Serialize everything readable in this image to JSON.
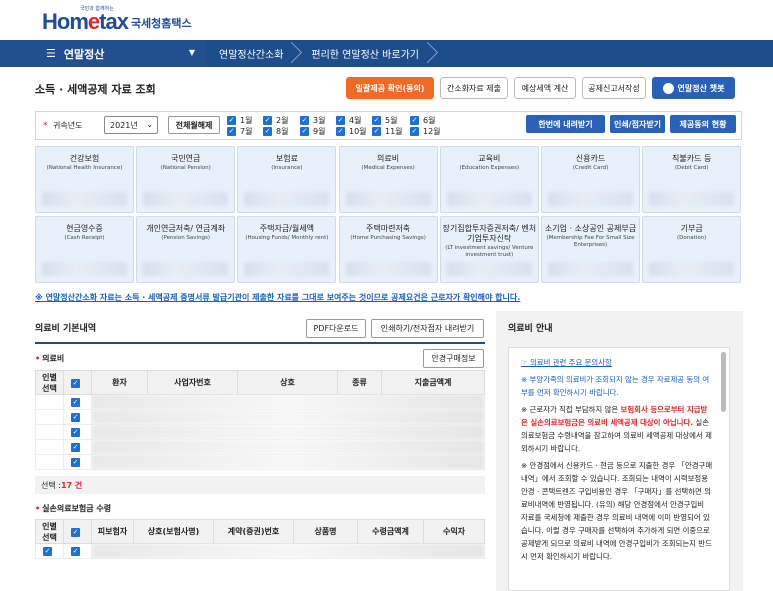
{
  "header": {
    "logo_text_home": "Hom",
    "logo_text_e": "e",
    "logo_text_tax": "tax",
    "logo_korean": "국세청홈택스",
    "logo_tagline": "국민과 함께하는"
  },
  "nav": {
    "menu_label": "연말정산",
    "crumbs": [
      "연말정산간소화",
      "편리한 연말정산 바로가기"
    ]
  },
  "page": {
    "title": "소득 · 세액공제 자료 조회",
    "buttons": {
      "bulk_consent": "일괄제공 확인(동의)",
      "simplified_submit": "간소화자료 제출",
      "tax_estimate": "예상세액 계산",
      "report_create": "공제신고서작성",
      "chatbot": "연말정산 챗봇"
    }
  },
  "filter": {
    "year_label": "귀속년도",
    "year_value": "2021년",
    "toggle_all": "전체월해제",
    "months_row1": [
      "1월",
      "2월",
      "3월",
      "4월",
      "5월",
      "6월"
    ],
    "months_row2": [
      "7월",
      "8월",
      "9월",
      "10월",
      "11월",
      "12월"
    ],
    "download_all": "한번에 내려받기",
    "print_download": "인쇄/점자받기",
    "provider_status": "제공동의 현황"
  },
  "categories": [
    {
      "ko": "건강보험",
      "en": "(National Health Insurance)"
    },
    {
      "ko": "국민연금",
      "en": "(National Pension)"
    },
    {
      "ko": "보험료",
      "en": "(Insurance)"
    },
    {
      "ko": "의료비",
      "en": "(Medical Expenses)"
    },
    {
      "ko": "교육비",
      "en": "(Education Expenses)"
    },
    {
      "ko": "신용카드",
      "en": "(Credit Card)"
    },
    {
      "ko": "직불카드 등",
      "en": "(Debit Card)"
    },
    {
      "ko": "현금영수증",
      "en": "(Cash Receipt)"
    },
    {
      "ko": "개인연금저축/ 연금계좌",
      "en": "(Pension Savings)"
    },
    {
      "ko": "주택자금/월세액",
      "en": "(Housing Funds/ Monthly rent)"
    },
    {
      "ko": "주택마련저축",
      "en": "(Home Purchasing Savings)"
    },
    {
      "ko": "장기집합투자증권저축/ 벤처기업투자신탁",
      "en": "(LT investment savings/ Venture investment trust)"
    },
    {
      "ko": "소기업 · 소상공인 공제부금",
      "en": "(Membership Fee For Small Size Enterprises)"
    },
    {
      "ko": "기부금",
      "en": "(Donation)"
    }
  ],
  "notice": "※ 연말정산간소화 자료는 소득 · 세액공제 증명서류 발급기관이 제출한 자료를 그대로 보여주는 것이므로 공제요건은 근로자가 확인해야 합니다.",
  "medical": {
    "section_title": "의료비 기본내역",
    "pdf_download": "PDF다운로드",
    "print_download": "인쇄하기/전자점자 내려받기",
    "sub1_title": "의료비",
    "glasses_info": "안경구매정보",
    "table1_headers": [
      "인별 선택",
      "",
      "환자",
      "사업자번호",
      "상호",
      "종류",
      "지출금액계"
    ],
    "selected_label": "선택 : ",
    "selected_count": "17 건",
    "sub2_title": "실손의료보험금 수령",
    "table2_headers": [
      "인별 선택",
      "",
      "피보험자",
      "상호(보험사명)",
      "계약(증권)번호",
      "상품명",
      "수령금액계",
      "수익자"
    ]
  },
  "info": {
    "title": "의료비 안내",
    "link": "☞ 의료비 관련 주요 문의사항",
    "p1": "※ 부양가족의 의료비가 조회되지 않는 경우 자료제공 동의 여부를 먼저 확인하시기 바랍니다.",
    "p2_a": "※ 근로자가 직접 부담하지 않은 ",
    "p2_b": "보험회사 등으로부터 지급받은 실손의료보험금은 의료비 세액공제 대상이 아닙니다.",
    "p2_c": " 실손의료보험금 수령내역을 참고하여 의료비 세액공제 대상에서 제외하시기 바랍니다.",
    "p3": "※ 안경점에서 신용카드 · 현금 등으로 지출한 경우 「안경구매내역」에서 조회할 수 있습니다. 조회되는 내역이 시력보정용 안경 · 콘택트렌즈 구입비용인 경우 「구매자」를 선택하면 의료비내역에 반영됩니다. (유의) 해당 안경점에서 안경구입비 자료를 국세청에 제출한 경우 의료비 내역에 이미 반영되어 있습니다. 이럴 경우 구매자를 선택하여 추가하게 되면 이중으로 공제받게 되므로 의료비 내역에 안경구입비가 조회되는지 반드시 먼저 확인하시기 바랍니다."
  }
}
